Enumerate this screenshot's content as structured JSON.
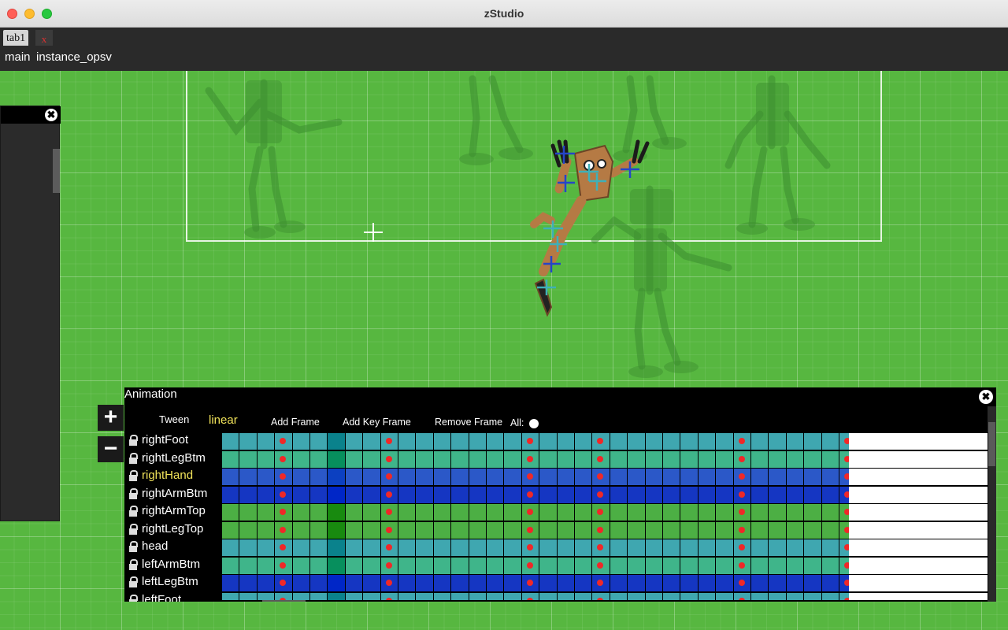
{
  "window": {
    "title": "zStudio"
  },
  "tabs": [
    {
      "label": "tab1",
      "close_label": "x"
    }
  ],
  "breadcrumb": {
    "main": "main",
    "instance": "instance_opsv"
  },
  "side_panel": {
    "close_label": "✖"
  },
  "zoom": {
    "in_label": "+",
    "out_label": "−"
  },
  "animation": {
    "title": "Animation",
    "close_label": "✖",
    "tween_label": "Tween",
    "tween_value": "linear",
    "add_frame_label": "Add Frame",
    "add_key_frame_label": "Add Key Frame",
    "remove_frame_label": "Remove Frame",
    "all_label": "All:",
    "bones": [
      {
        "name": "rightFoot",
        "color": "#3fa7b0",
        "selected": false
      },
      {
        "name": "rightLegBtm",
        "color": "#3fb58a",
        "selected": false
      },
      {
        "name": "rightHand",
        "color": "#2b58c8",
        "selected": true
      },
      {
        "name": "rightArmBtm",
        "color": "#1536c2",
        "selected": false
      },
      {
        "name": "rightArmTop",
        "color": "#4caf44",
        "selected": false
      },
      {
        "name": "rightLegTop",
        "color": "#4caf44",
        "selected": false
      },
      {
        "name": "head",
        "color": "#3fa7b0",
        "selected": false
      },
      {
        "name": "leftArmBtm",
        "color": "#3fb58a",
        "selected": false
      },
      {
        "name": "leftLegBtm",
        "color": "#1536c2",
        "selected": false
      },
      {
        "name": "leftFoot",
        "color": "#3fa7b0",
        "selected": false
      }
    ],
    "frame_count": 36,
    "current_frame": 6,
    "key_frames": [
      3,
      9,
      17,
      21,
      29,
      35
    ]
  }
}
